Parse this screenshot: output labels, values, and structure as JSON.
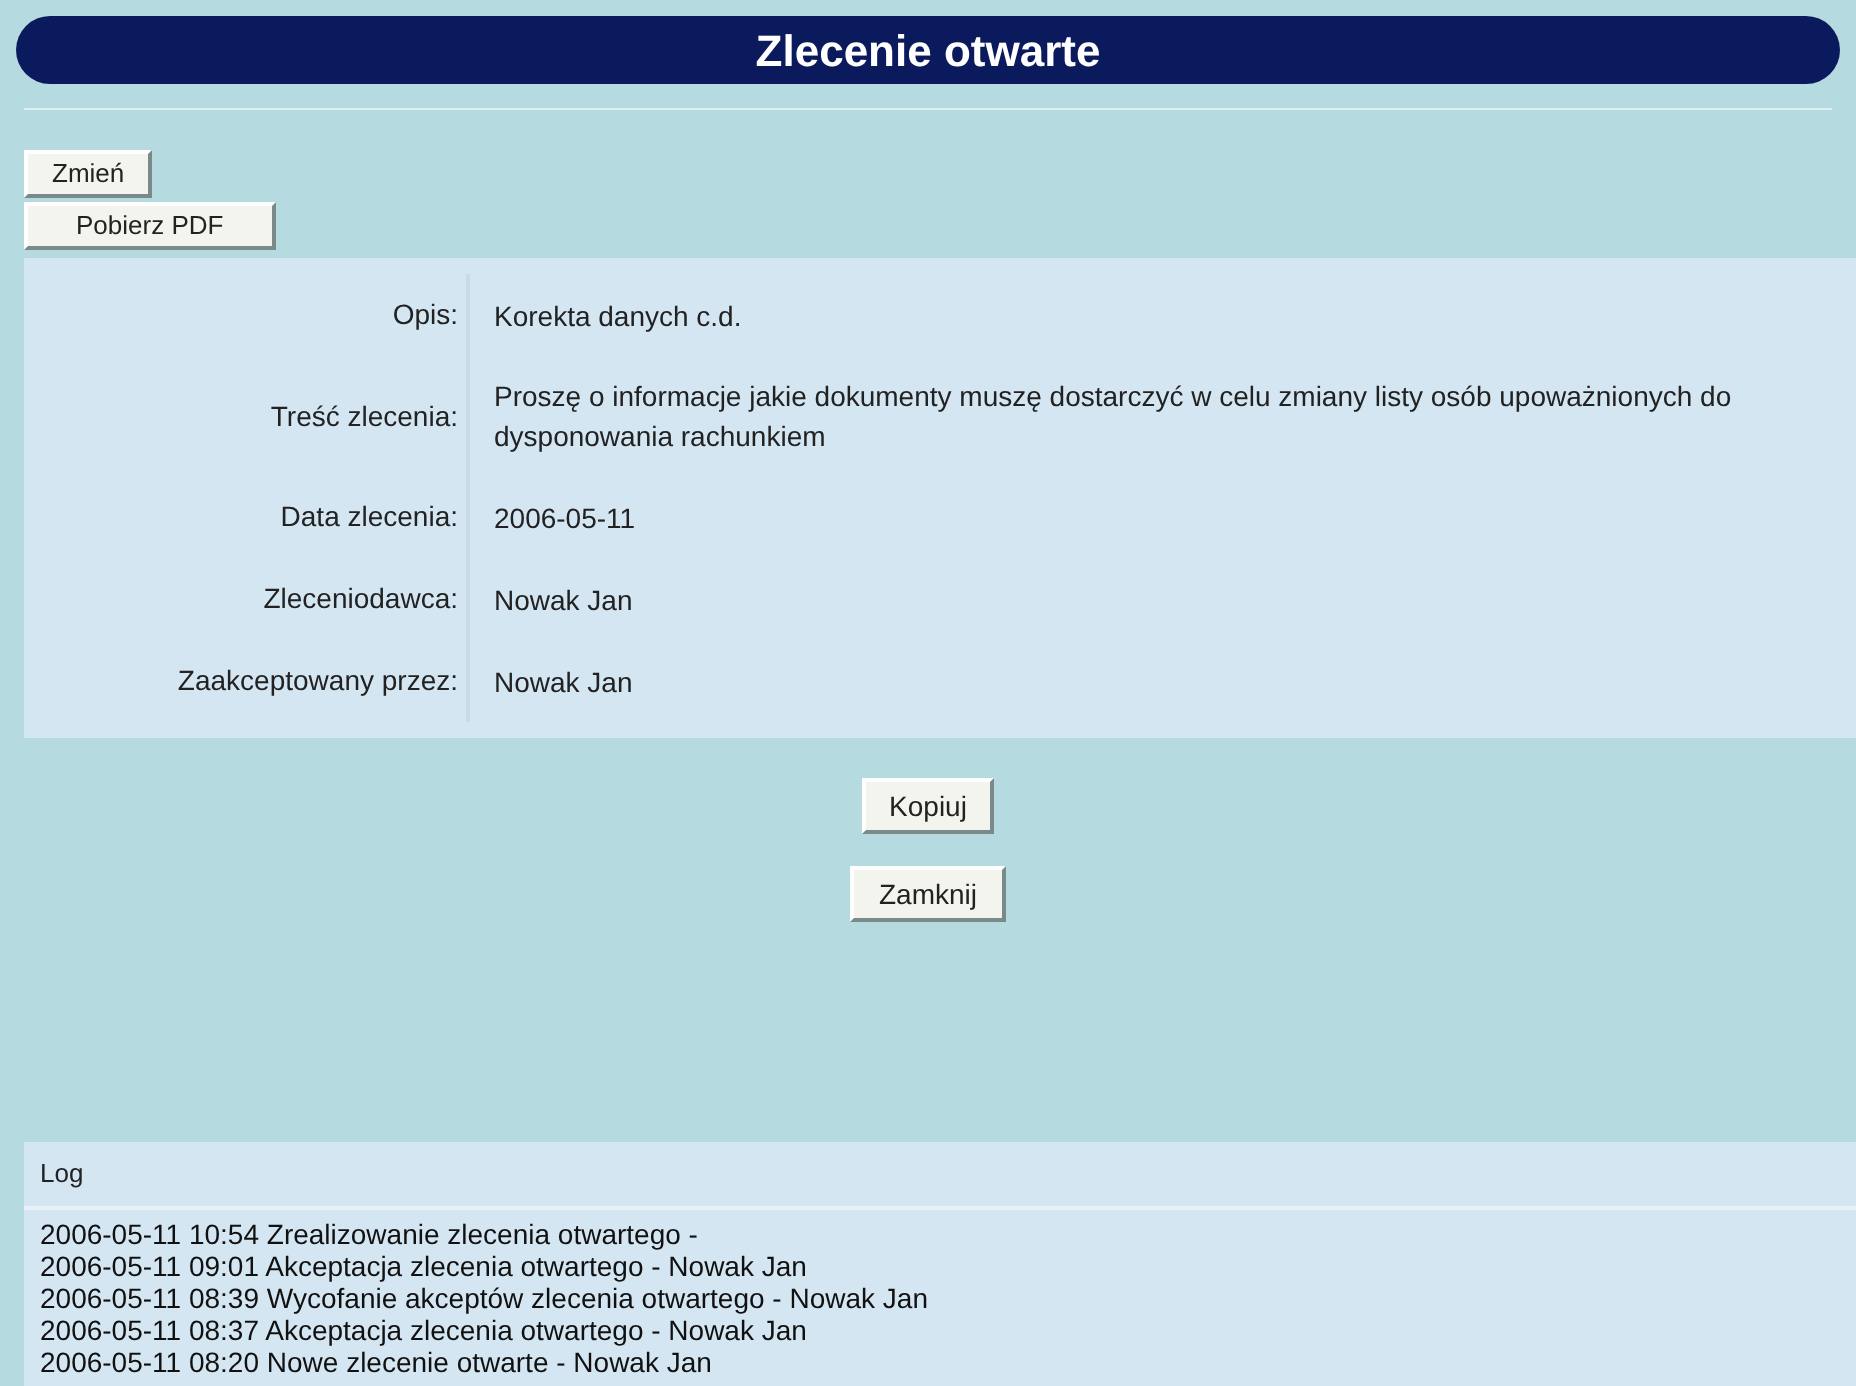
{
  "title": "Zlecenie otwarte",
  "top_buttons": [
    "Zmień",
    "Pobierz PDF"
  ],
  "fields": [
    {
      "label": "Opis:",
      "value": "Korekta danych c.d."
    },
    {
      "label": "Treść zlecenia:",
      "value": "Proszę o informacje jakie dokumenty muszę dostarczyć w celu zmiany listy osób upoważnionych do dysponowania rachunkiem"
    },
    {
      "label": "Data zlecenia:",
      "value": "2006-05-11"
    },
    {
      "label": "Zleceniodawca:",
      "value": "Nowak Jan"
    },
    {
      "label": "Zaakceptowany przez:",
      "value": "Nowak Jan"
    }
  ],
  "actions": [
    "Kopiuj",
    "Zamknij"
  ],
  "log": {
    "title": "Log",
    "entries": [
      "2006-05-11 10:54 Zrealizowanie zlecenia otwartego -",
      "2006-05-11 09:01 Akceptacja zlecenia otwartego - Nowak Jan",
      "2006-05-11 08:39 Wycofanie akceptów zlecenia otwartego - Nowak Jan",
      "2006-05-11 08:37 Akceptacja zlecenia otwartego - Nowak Jan",
      "2006-05-11 08:20 Nowe zlecenie otwarte - Nowak Jan"
    ]
  }
}
